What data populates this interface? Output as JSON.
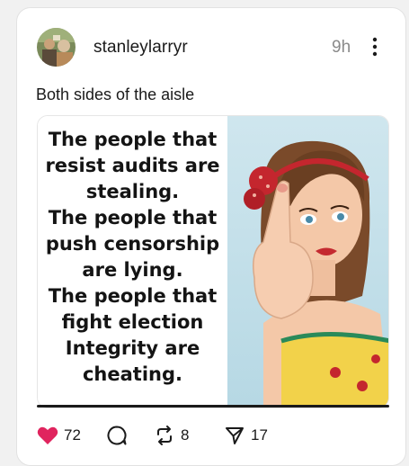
{
  "post": {
    "username": "stanleylarryr",
    "time": "9h",
    "caption": "Both sides of the aisle",
    "meme_text": "The people that\nresist audits are\nstealing.\nThe people that\npush censorship\nare lying.\nThe people that\nfight election\nIntegrity are\ncheating.",
    "actions": {
      "like_count": "72",
      "repost_count": "8",
      "share_count": "17"
    }
  },
  "colors": {
    "like": "#e0245e",
    "text": "#1a1a1a",
    "muted": "#8a8a8a"
  },
  "icons": [
    "avatar-photo",
    "more-vertical-icon",
    "heart-icon",
    "comment-icon",
    "repost-icon",
    "share-icon"
  ]
}
